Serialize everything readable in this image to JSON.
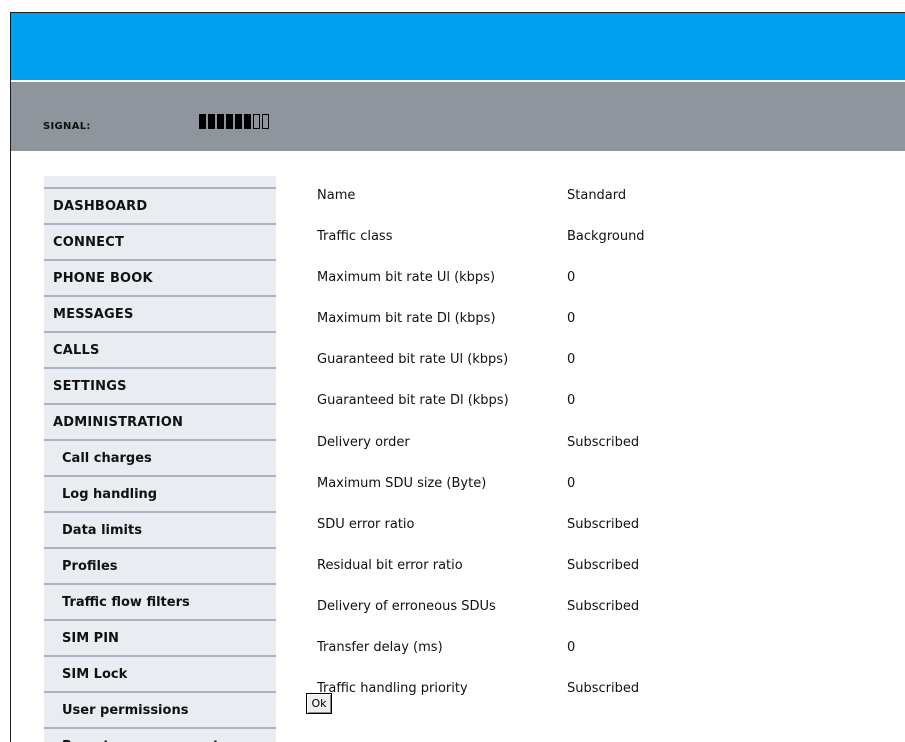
{
  "status": {
    "signal_label": "SIGNAL:",
    "signal_level": 6,
    "signal_max": 8
  },
  "sidebar": {
    "items": [
      {
        "label": "DASHBOARD",
        "level": "main"
      },
      {
        "label": "CONNECT",
        "level": "main"
      },
      {
        "label": "PHONE BOOK",
        "level": "main"
      },
      {
        "label": "MESSAGES",
        "level": "main"
      },
      {
        "label": "CALLS",
        "level": "main"
      },
      {
        "label": "SETTINGS",
        "level": "main"
      },
      {
        "label": "ADMINISTRATION",
        "level": "main"
      },
      {
        "label": "Call charges",
        "level": "sub"
      },
      {
        "label": "Log handling",
        "level": "sub"
      },
      {
        "label": "Data limits",
        "level": "sub"
      },
      {
        "label": "Profiles",
        "level": "sub"
      },
      {
        "label": "Traffic flow filters",
        "level": "sub"
      },
      {
        "label": "SIM PIN",
        "level": "sub"
      },
      {
        "label": "SIM Lock",
        "level": "sub"
      },
      {
        "label": "User permissions",
        "level": "sub"
      },
      {
        "label": "Remote management",
        "level": "sub"
      }
    ]
  },
  "profile": {
    "rows": [
      {
        "label": "Name",
        "value": "Standard"
      },
      {
        "label": "Traffic class",
        "value": "Background"
      },
      {
        "label": "Maximum bit rate Ul (kbps)",
        "value": "0"
      },
      {
        "label": "Maximum bit rate Dl (kbps)",
        "value": "0"
      },
      {
        "label": "Guaranteed bit rate Ul (kbps)",
        "value": "0"
      },
      {
        "label": "Guaranteed bit rate Dl (kbps)",
        "value": "0"
      },
      {
        "label": "Delivery order",
        "value": "Subscribed"
      },
      {
        "label": "Maximum SDU size (Byte)",
        "value": "0"
      },
      {
        "label": "SDU error ratio",
        "value": "Subscribed"
      },
      {
        "label": "Residual bit error ratio",
        "value": "Subscribed"
      },
      {
        "label": "Delivery of erroneous SDUs",
        "value": "Subscribed"
      },
      {
        "label": "Transfer delay (ms)",
        "value": "0"
      },
      {
        "label": "Traffic handling priority",
        "value": "Subscribed"
      }
    ],
    "ok_label": "Ok"
  },
  "colors": {
    "header": "#00a0f0",
    "statusbar": "#8e959c",
    "sidebar_bg": "#e9ecf1",
    "sidebar_divider": "#aab4c0"
  }
}
